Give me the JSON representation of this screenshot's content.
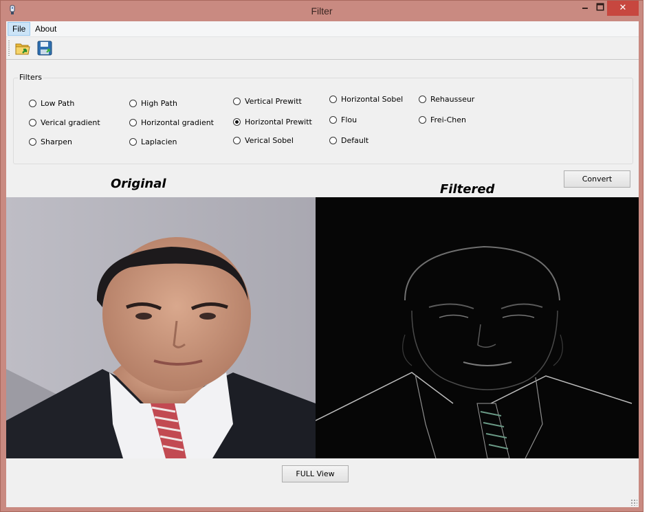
{
  "window": {
    "title": "Filter",
    "minimize_glyph": "🗕",
    "maximize_glyph": "🗖",
    "close_glyph": "✕"
  },
  "menu": {
    "file": "File",
    "about": "About"
  },
  "toolbar": {
    "icons": [
      "open-folder-icon",
      "save-icon"
    ]
  },
  "filters": {
    "group_label": "Filters",
    "options": {
      "low_path": "Low Path",
      "verical_gradient": "Verical gradient",
      "sharpen": "Sharpen",
      "high_path": "High Path",
      "horizontal_gradient": "Horizontal gradient",
      "laplacien": "Laplacien",
      "vertical_prewitt": "Vertical Prewitt",
      "horizontal_prewitt": "Horizontal Prewitt",
      "verical_sobel": "Verical Sobel",
      "horizontal_sobel": "Horizontal Sobel",
      "flou": "Flou",
      "default": "Default",
      "rehausseur": "Rehausseur",
      "frei_chen": "Frei-Chen"
    },
    "selected": "Horizontal Prewitt"
  },
  "buttons": {
    "convert": "Convert",
    "full_view": "FULL View"
  },
  "captions": {
    "original": "Original",
    "filtered": "Filtered"
  },
  "colors": {
    "title_bar": "#c98a81",
    "close_button": "#c7473f",
    "menu_selected": "#cce4f7"
  }
}
